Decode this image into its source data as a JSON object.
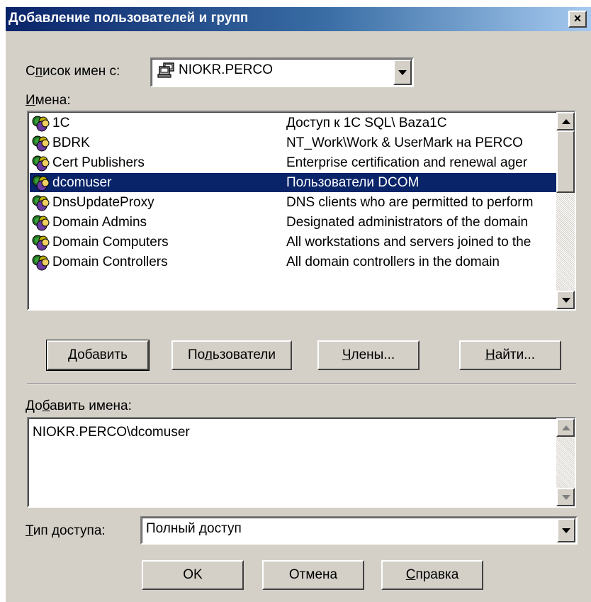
{
  "window": {
    "title": "Добавление пользователей и групп",
    "close_glyph": "×"
  },
  "source": {
    "label_pre": "С",
    "label_u": "п",
    "label_post": "исок имен с:",
    "value": "NIOKR.PERCO",
    "icon": "network-computer-icon"
  },
  "names": {
    "label_u": "И",
    "label_post": "мена:",
    "rows": [
      {
        "name": "1C",
        "desc": "Доступ к 1С SQL\\ Baza1C"
      },
      {
        "name": "BDRK",
        "desc": "NT_Work\\Work & UserMark на PERCO"
      },
      {
        "name": "Cert Publishers",
        "desc": "Enterprise certification and renewal ager"
      },
      {
        "name": "dcomuser",
        "desc": "Пользователи DCOM",
        "selected": true
      },
      {
        "name": "DnsUpdateProxy",
        "desc": "DNS clients who are permitted to perform"
      },
      {
        "name": "Domain Admins",
        "desc": "Designated administrators of the domain"
      },
      {
        "name": "Domain Computers",
        "desc": "All workstations and servers joined to the"
      },
      {
        "name": "Domain Controllers",
        "desc": "All domain controllers in the domain"
      }
    ]
  },
  "actions": {
    "add": {
      "u": "Д",
      "post": "обавить"
    },
    "users": {
      "pre": "По",
      "u": "л",
      "post": "ьзователи"
    },
    "members": {
      "u": "Ч",
      "post": "лены..."
    },
    "find": {
      "u": "Н",
      "post": "айти..."
    }
  },
  "add_names": {
    "label_pre": "До",
    "label_u": "б",
    "label_post": "авить имена:",
    "value": "NIOKR.PERCO\\dcomuser"
  },
  "access": {
    "label_u": "Т",
    "label_post": "ип доступа:",
    "value": "Полный доступ"
  },
  "footer": {
    "ok": "OK",
    "cancel": "Отмена",
    "help_u": "С",
    "help_post": "правка"
  },
  "colors": {
    "selection": "#0a246a",
    "face": "#d4d0c8",
    "title_start": "#0a246a",
    "title_end": "#a6caf0"
  }
}
